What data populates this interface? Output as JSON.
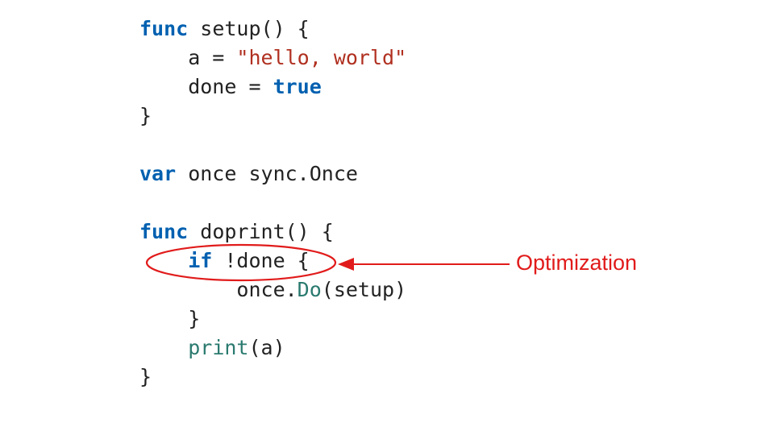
{
  "annotation": {
    "label": "Optimization",
    "color": "#e11b1b"
  },
  "code": {
    "lines": [
      [
        {
          "cls": "tok-keyword",
          "text": "func"
        },
        {
          "cls": "tok-plain",
          "text": " setup() {"
        }
      ],
      [
        {
          "cls": "tok-plain",
          "text": "    a = "
        },
        {
          "cls": "tok-string",
          "text": "\"hello, world\""
        }
      ],
      [
        {
          "cls": "tok-plain",
          "text": "    done = "
        },
        {
          "cls": "tok-bool",
          "text": "true"
        }
      ],
      [
        {
          "cls": "tok-plain",
          "text": "}"
        }
      ],
      [
        {
          "cls": "tok-plain",
          "text": ""
        }
      ],
      [
        {
          "cls": "tok-keyword",
          "text": "var"
        },
        {
          "cls": "tok-plain",
          "text": " once sync.Once"
        }
      ],
      [
        {
          "cls": "tok-plain",
          "text": ""
        }
      ],
      [
        {
          "cls": "tok-keyword",
          "text": "func"
        },
        {
          "cls": "tok-plain",
          "text": " doprint() {"
        }
      ],
      [
        {
          "cls": "tok-plain",
          "text": "    "
        },
        {
          "cls": "tok-keyword",
          "text": "if"
        },
        {
          "cls": "tok-plain",
          "text": " !done {"
        }
      ],
      [
        {
          "cls": "tok-plain",
          "text": "        once."
        },
        {
          "cls": "tok-call",
          "text": "Do"
        },
        {
          "cls": "tok-plain",
          "text": "(setup)"
        }
      ],
      [
        {
          "cls": "tok-plain",
          "text": "    }"
        }
      ],
      [
        {
          "cls": "tok-plain",
          "text": "    "
        },
        {
          "cls": "tok-call",
          "text": "print"
        },
        {
          "cls": "tok-plain",
          "text": "(a)"
        }
      ],
      [
        {
          "cls": "tok-plain",
          "text": "}"
        }
      ]
    ]
  }
}
